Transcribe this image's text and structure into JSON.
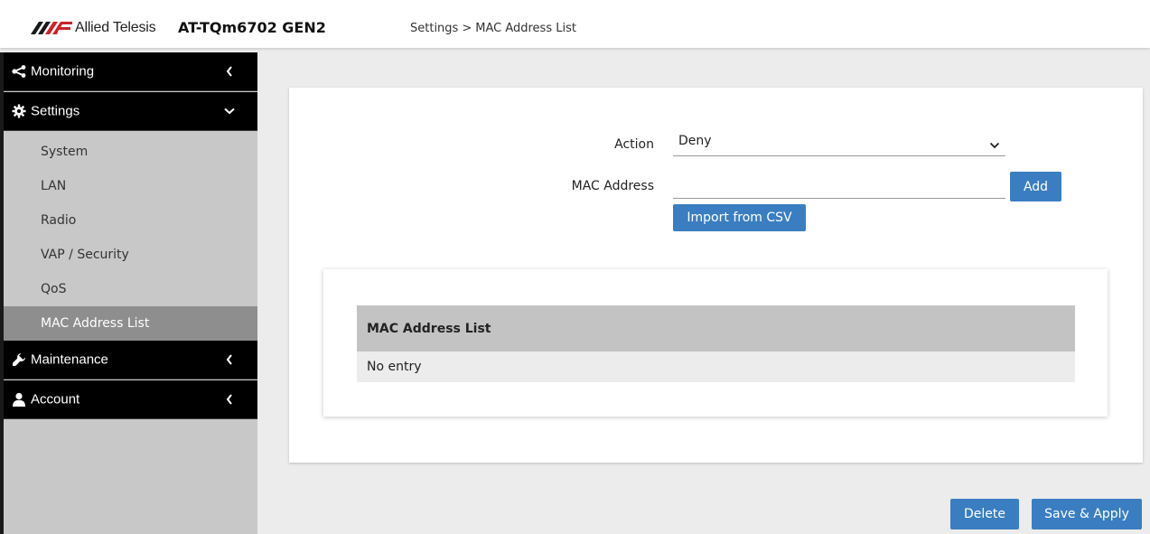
{
  "header": {
    "brand_name": "Allied Telesis",
    "model": "AT-TQm6702 GEN2",
    "breadcrumb": [
      "Settings",
      "MAC Address List"
    ],
    "breadcrumb_separator": ">"
  },
  "sidebar": {
    "sections": [
      {
        "label": "Monitoring",
        "icon": "share-icon",
        "chevron": "chevron-left-icon"
      },
      {
        "label": "Settings",
        "icon": "gear-icon",
        "chevron": "chevron-down-icon"
      },
      {
        "label": "Maintenance",
        "icon": "wrench-icon",
        "chevron": "chevron-left-icon"
      },
      {
        "label": "Account",
        "icon": "user-icon",
        "chevron": "chevron-left-icon"
      }
    ],
    "settings_items": [
      "System",
      "LAN",
      "Radio",
      "VAP / Security",
      "QoS",
      "MAC Address List"
    ],
    "active_item": "MAC Address List"
  },
  "form": {
    "action_label": "Action",
    "action_value": "Deny",
    "mac_label": "MAC Address",
    "mac_value": "",
    "add_button": "Add",
    "import_button": "Import from CSV"
  },
  "table": {
    "header": "MAC Address List",
    "rows": [
      "No entry"
    ]
  },
  "footer": {
    "delete_button": "Delete",
    "save_button": "Save & Apply"
  },
  "colors": {
    "button": "#3a7ec1",
    "sidebar_bg": "#c8c8c8",
    "nav_bg": "#000000",
    "active_item_bg": "#8e8e8e"
  }
}
